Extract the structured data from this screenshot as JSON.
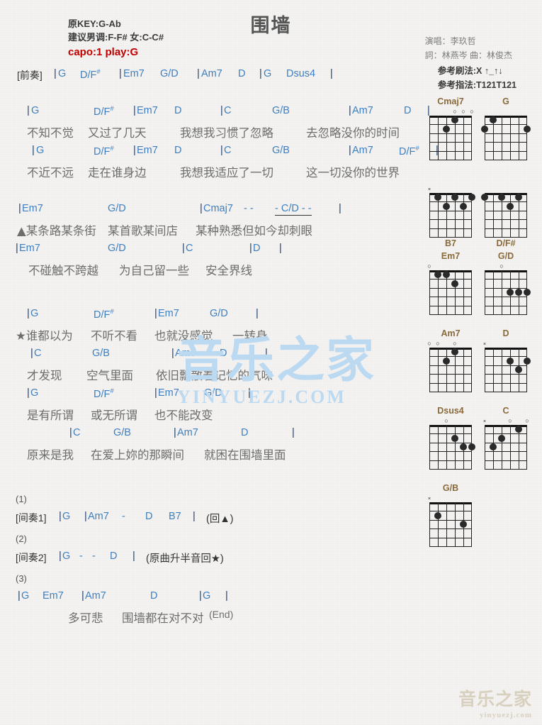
{
  "header": {
    "title": "围墙",
    "key_line": "原KEY:G-Ab",
    "suggest_line": "建议男调:F-F# 女:C-C#",
    "capo_line": "capo:1 play:G",
    "singer": "演唱：李玖哲",
    "writers": "詞：林燕岑  曲：林俊杰",
    "strum": "参考刷法:X ↑_↑↓",
    "fingering": "参考指法:T121T121",
    "capo_color": "#c00000",
    "chord_color": "#3d7fc1"
  },
  "sections": {
    "intro_label": "[前奏]",
    "interlude1_label": "[间奏1]",
    "interlude2_label": "[间奏2]",
    "num1": "(1)",
    "num2": "(2)",
    "num3": "(3)",
    "marker_triangle": "▲",
    "marker_star": "★",
    "back_to_triangle": "(回▲)",
    "interlude2_note": "(原曲升半音回★)",
    "end_note": "(End)"
  },
  "chords": {
    "G": "G",
    "DF": "D/F",
    "Em7": "Em7",
    "GD": "G/D",
    "Am7": "Am7",
    "D": "D",
    "Dsus4": "Dsus4",
    "C": "C",
    "GB": "G/B",
    "Cmaj7": "Cmaj7",
    "CD": "C/D",
    "B7": "B7",
    "sharp": "#",
    "bar": "|",
    "dash": "-"
  },
  "intro": {
    "chords": [
      "G",
      "D/F#",
      "Em7",
      "G/D",
      "Am7",
      "D",
      "G",
      "Dsus4"
    ]
  },
  "verses": [
    {
      "chords": [
        "G",
        "D/F#",
        "Em7",
        "D",
        "C",
        "G/B",
        "Am7",
        "D"
      ],
      "lyrics": [
        "不知不觉",
        "又过了几天",
        "我想我习惯了忽略",
        "去忽略没你的时间"
      ]
    },
    {
      "chords": [
        "G",
        "D/F#",
        "Em7",
        "D",
        "C",
        "G/B",
        "Am7",
        "D/F#"
      ],
      "lyrics": [
        "不近不远",
        "走在谁身边",
        "我想我适应了一切",
        "这一切没你的世界"
      ]
    },
    {
      "chords": [
        "Em7",
        "G/D",
        "Cmaj7",
        "- -",
        "- C/D - -"
      ],
      "lyrics": [
        "▲某条路某条街",
        "某首歌某间店",
        "某种熟悉但如今却刺眼"
      ]
    },
    {
      "chords": [
        "Em7",
        "G/D",
        "C",
        "D"
      ],
      "lyrics": [
        "不碰触不跨越",
        "为自己留一些",
        "安全界线"
      ]
    },
    {
      "chords": [
        "G",
        "D/F#",
        "Em7",
        "G/D"
      ],
      "lyrics": [
        "★谁都以为",
        "不听不看",
        "也就没感觉",
        "一转身"
      ]
    },
    {
      "chords": [
        "C",
        "G/B",
        "Am7",
        "D"
      ],
      "lyrics": [
        "才发现",
        "空气里面",
        "依旧飘散着记忆的气味"
      ]
    },
    {
      "chords": [
        "G",
        "D/F#",
        "Em7",
        "G/D"
      ],
      "lyrics": [
        "是有所谓",
        "或无所谓",
        "也不能改变"
      ]
    },
    {
      "chords": [
        "C",
        "G/B",
        "Am7",
        "D"
      ],
      "lyrics": [
        "原来是我",
        "在爱上妳的那瞬间",
        "就困在围墙里面"
      ]
    }
  ],
  "interlude1": {
    "chords": [
      "G",
      "Am7",
      "-",
      "D",
      "B7"
    ]
  },
  "interlude2": {
    "chords": [
      "G",
      "-",
      "-",
      "D"
    ]
  },
  "ending": {
    "chords": [
      "G",
      "Em7",
      "Am7",
      "D",
      "G"
    ],
    "lyrics": [
      "多可悲",
      "围墙都在对不对"
    ]
  },
  "diagrams": [
    {
      "name": "Cmaj7",
      "label_pos": "top",
      "markers": [
        "",
        "",
        "",
        "o",
        "o",
        "o"
      ],
      "dots": [
        [
          2,
          4
        ],
        [
          1,
          3
        ]
      ]
    },
    {
      "name": "G",
      "label_pos": "top",
      "markers": [
        "",
        "",
        "",
        "",
        "",
        ""
      ],
      "dots": [
        [
          2,
          6
        ],
        [
          1,
          5
        ],
        [
          2,
          1
        ]
      ]
    },
    {
      "name": "B7",
      "label_pos": "bottom",
      "markers": [
        "x",
        "",
        "",
        "",
        "",
        ""
      ],
      "dots": [
        [
          1,
          5
        ],
        [
          2,
          4
        ],
        [
          1,
          3
        ],
        [
          2,
          2
        ],
        [
          1,
          1
        ]
      ]
    },
    {
      "name": "D/F#",
      "label_pos": "bottom",
      "markers": [
        "",
        "",
        "",
        "",
        "",
        ""
      ],
      "dots": [
        [
          1,
          6
        ],
        [
          1,
          4
        ],
        [
          2,
          3
        ],
        [
          1,
          2
        ]
      ]
    },
    {
      "name": "Em7",
      "label_pos": "top",
      "markers": [
        "o",
        "",
        "",
        "",
        "",
        ""
      ],
      "dots": [
        [
          1,
          5
        ],
        [
          1,
          4
        ],
        [
          2,
          3
        ]
      ]
    },
    {
      "name": "G/D",
      "label_pos": "top",
      "markers": [
        "",
        "",
        "o",
        "",
        "",
        ""
      ],
      "dots": [
        [
          3,
          3
        ],
        [
          3,
          2
        ],
        [
          3,
          1
        ]
      ]
    },
    {
      "name": "Am7",
      "label_pos": "top",
      "markers": [
        "o",
        "o",
        "",
        "o",
        "",
        ""
      ],
      "dots": [
        [
          1,
          3
        ],
        [
          2,
          4
        ]
      ]
    },
    {
      "name": "D",
      "label_pos": "top",
      "markers": [
        "x",
        "",
        "",
        "",
        "",
        ""
      ],
      "dots": [
        [
          2,
          3
        ],
        [
          3,
          2
        ],
        [
          2,
          1
        ]
      ]
    },
    {
      "name": "Dsus4",
      "label_pos": "top",
      "markers": [
        "",
        "",
        "o",
        "",
        "",
        ""
      ],
      "dots": [
        [
          2,
          3
        ],
        [
          3,
          2
        ],
        [
          3,
          1
        ]
      ]
    },
    {
      "name": "C",
      "label_pos": "top",
      "markers": [
        "x",
        "",
        "",
        "o",
        "",
        "o"
      ],
      "dots": [
        [
          3,
          5
        ],
        [
          2,
          4
        ],
        [
          1,
          2
        ]
      ]
    },
    {
      "name": "G/B",
      "label_pos": "top",
      "markers": [
        "x",
        "",
        "",
        "",
        "",
        ""
      ],
      "dots": [
        [
          2,
          5
        ],
        [
          3,
          2
        ]
      ]
    }
  ],
  "watermark": {
    "main_cn": "音乐之家",
    "main_url": "YINYUEZJ.COM",
    "corner_cn": "音乐之家",
    "corner_url": "yinyuezj.com"
  }
}
